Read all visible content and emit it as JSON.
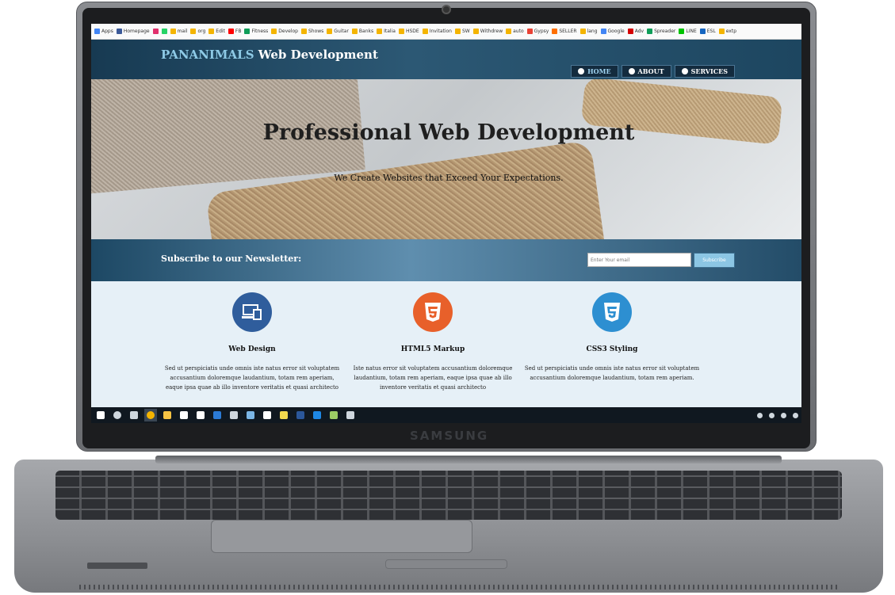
{
  "device": {
    "brand": "SAMSUNG"
  },
  "bookmarks": [
    {
      "label": "Apps",
      "color": "#4285f4"
    },
    {
      "label": "Homepage",
      "color": "#3b5998"
    },
    {
      "label": "",
      "color": "#e1306c"
    },
    {
      "label": "",
      "color": "#25d366"
    },
    {
      "label": "mail",
      "color": "#f4b400"
    },
    {
      "label": "org",
      "color": "#f4b400"
    },
    {
      "label": "Edit",
      "color": "#f4b400"
    },
    {
      "label": "FB",
      "color": "#ff0000"
    },
    {
      "label": "Fitness",
      "color": "#0f9d58"
    },
    {
      "label": "Develop",
      "color": "#f4b400"
    },
    {
      "label": "Shows",
      "color": "#f4b400"
    },
    {
      "label": "Guitar",
      "color": "#f4b400"
    },
    {
      "label": "Banks",
      "color": "#f4b400"
    },
    {
      "label": "Italia",
      "color": "#f4b400"
    },
    {
      "label": "HSDE",
      "color": "#f4b400"
    },
    {
      "label": "Invitation",
      "color": "#f4b400"
    },
    {
      "label": "SW",
      "color": "#f4b400"
    },
    {
      "label": "Withdrew",
      "color": "#f4b400"
    },
    {
      "label": "auto",
      "color": "#f4b400"
    },
    {
      "label": "Gypsy",
      "color": "#e94235"
    },
    {
      "label": "SELLER",
      "color": "#ff6f00"
    },
    {
      "label": "lang",
      "color": "#f4b400"
    },
    {
      "label": "Google",
      "color": "#4285f4"
    },
    {
      "label": "Adv",
      "color": "#d50000"
    },
    {
      "label": "Spreader",
      "color": "#0f9d58"
    },
    {
      "label": "LINE",
      "color": "#00c300"
    },
    {
      "label": "ESL",
      "color": "#1565c0"
    },
    {
      "label": "extp",
      "color": "#f4b400"
    }
  ],
  "site": {
    "brand_highlight": "PANANIMALS",
    "brand_rest": "Web Development",
    "nav": [
      {
        "label": "HOME",
        "icon": "home-icon"
      },
      {
        "label": "ABOUT",
        "icon": "chat-icon"
      },
      {
        "label": "SERVICES",
        "icon": "globe-icon"
      }
    ],
    "hero": {
      "title": "Professional Web Development",
      "subtitle": "We Create Websites that Exceed Your Expectations."
    },
    "newsletter": {
      "label": "Subscribe to our Newsletter:",
      "placeholder": "Enter Your email",
      "button": "Subscribe"
    },
    "features": [
      {
        "title": "Web Design",
        "icon": "devices-icon",
        "color": "#2f5d9c",
        "text": "Sed ut perspiciatis unde omnis iste natus error sit voluptatem accusantium doloremque laudantium, totam rem aperiam, eaque ipsa quae ab illo inventore veritatis et quasi architecto"
      },
      {
        "title": "HTML5 Markup",
        "icon": "html5-icon",
        "color": "#e8602a",
        "text": "Iste natus error sit voluptatem accusantium doloremque laudantium, totam rem aperiam, eaque ipsa quae ab illo inventore veritatis et quasi architecto"
      },
      {
        "title": "CSS3 Styling",
        "icon": "css3-icon",
        "color": "#2d8fd1",
        "text": "Sed ut perspiciatis unde omnis iste natus error sit voluptatem accusantium doloremque laudantium, totam rem aperiam."
      }
    ]
  },
  "taskbar": {
    "apps": [
      {
        "name": "start",
        "color": "#ffffff"
      },
      {
        "name": "search",
        "color": "#cfd7de"
      },
      {
        "name": "task-view",
        "color": "#cfd7de"
      },
      {
        "name": "chrome",
        "color": "#f4b400"
      },
      {
        "name": "file-explorer",
        "color": "#f6c344"
      },
      {
        "name": "store",
        "color": "#ffffff"
      },
      {
        "name": "mail",
        "color": "#ffffff"
      },
      {
        "name": "vscode",
        "color": "#2b7bd6"
      },
      {
        "name": "terminal",
        "color": "#cfd7de"
      },
      {
        "name": "notepad",
        "color": "#7bb6e6"
      },
      {
        "name": "document",
        "color": "#ffffff"
      },
      {
        "name": "sticky-notes",
        "color": "#f2d94e"
      },
      {
        "name": "word",
        "color": "#2b579a"
      },
      {
        "name": "edge",
        "color": "#1e88e5"
      },
      {
        "name": "snipping",
        "color": "#9ccc65"
      },
      {
        "name": "calculator",
        "color": "#cfd7de"
      }
    ]
  }
}
